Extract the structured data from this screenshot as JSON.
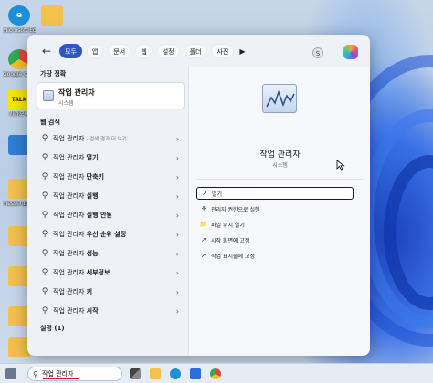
{
  "desktop": {
    "icons": [
      {
        "label": "Microsoft Edge",
        "icon": "edge-icon",
        "color": "#1d8fd8"
      },
      {
        "label": "Google Chrome",
        "icon": "chrome-icon",
        "color": "#e8453c"
      },
      {
        "label": "카카오톡",
        "icon": "kakaotalk-icon",
        "color": "#3a1d1d"
      },
      {
        "label": "",
        "icon": "monitor-icon",
        "color": "#2f7fd6"
      },
      {
        "label": "Messenger Downloads",
        "icon": "folder-icon",
        "color": "#f2c14e"
      },
      {
        "label": "",
        "icon": "folder-icon",
        "color": "#f2c14e"
      },
      {
        "label": "",
        "icon": "folder-icon",
        "color": "#f2c14e"
      },
      {
        "label": "",
        "icon": "folder-icon",
        "color": "#f2c14e"
      },
      {
        "label": "",
        "icon": "folder-icon",
        "color": "#f2c14e"
      }
    ],
    "top_folder": {
      "label": "",
      "icon": "folder-icon"
    }
  },
  "filters": {
    "back_icon": "arrow-left-icon",
    "chips": [
      "모두",
      "앱",
      "문서",
      "웹",
      "설정",
      "폴더",
      "사진"
    ],
    "active": "모두",
    "more_icon": "play-icon",
    "avatar_letter": "S",
    "copilot_icon": "copilot-icon"
  },
  "best_match": {
    "heading": "가장 정확",
    "title": "작업 관리자",
    "subtitle": "시스템"
  },
  "web_search": {
    "heading": "웹 검색",
    "items": [
      {
        "query": "작업 관리자",
        "bold": "",
        "suffix": " - 검색 결과 더 보기"
      },
      {
        "query": "작업 관리자 ",
        "bold": "열기",
        "suffix": ""
      },
      {
        "query": "작업 관리자 ",
        "bold": "단축키",
        "suffix": ""
      },
      {
        "query": "작업 관리자 ",
        "bold": "실행",
        "suffix": ""
      },
      {
        "query": "작업 관리자 ",
        "bold": "실행 안됨",
        "suffix": ""
      },
      {
        "query": "작업 관리자 ",
        "bold": "우선 순위 설정",
        "suffix": ""
      },
      {
        "query": "작업 관리자 ",
        "bold": "성능",
        "suffix": ""
      },
      {
        "query": "작업 관리자 ",
        "bold": "세부정보",
        "suffix": ""
      },
      {
        "query": "작업 관리자 ",
        "bold": "키",
        "suffix": ""
      },
      {
        "query": "작업 관리자 ",
        "bold": "시작",
        "suffix": ""
      }
    ],
    "settings_heading": "설정 (1)"
  },
  "details": {
    "title": "작업 관리자",
    "subtitle": "시스템",
    "actions": [
      {
        "label": "열기",
        "icon": "open-icon"
      },
      {
        "label": "관리자 권한으로 실행",
        "icon": "shield-icon"
      },
      {
        "label": "파일 위치 열기",
        "icon": "folder-icon"
      },
      {
        "label": "시작 화면에 고정",
        "icon": "pin-icon"
      },
      {
        "label": "작업 표시줄에 고정",
        "icon": "pin-icon"
      }
    ]
  },
  "taskbar": {
    "search_value": "작업 관리자",
    "search_icon": "search-icon",
    "apps": [
      "task-view-icon",
      "file-explorer-icon",
      "edge-icon",
      "store-icon",
      "chrome-icon"
    ]
  }
}
